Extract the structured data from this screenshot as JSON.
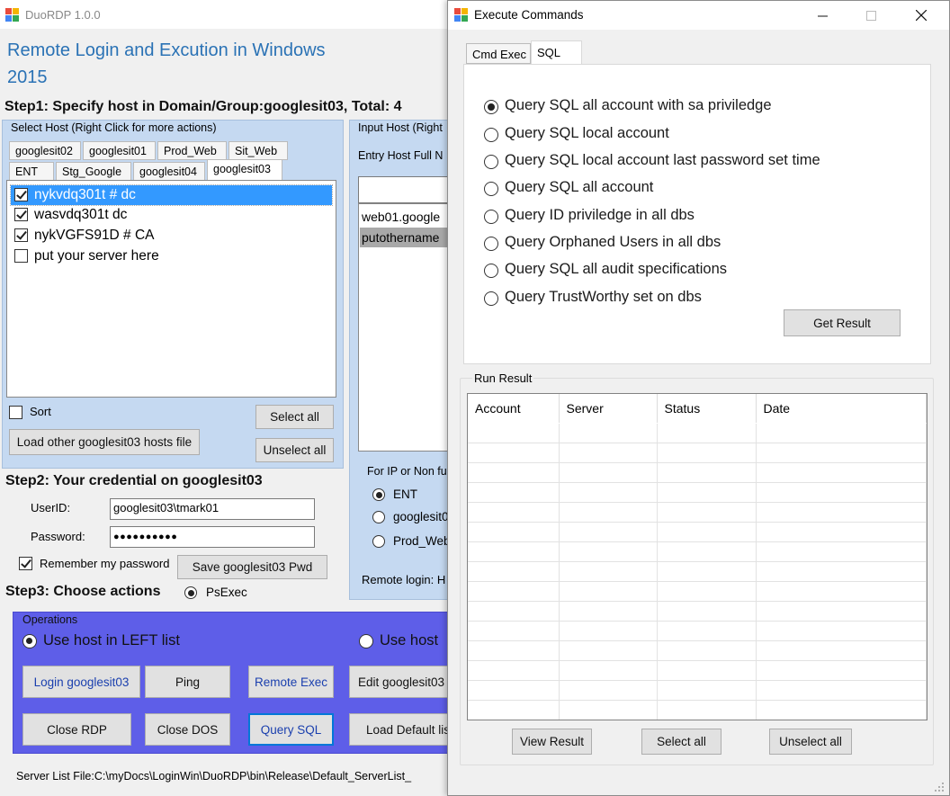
{
  "main_window": {
    "title": "DuoRDP 1.0.0",
    "heading_line1": "Remote Login and Excution in Windows",
    "heading_line2": "2015",
    "step1_label": "Step1: Specify host in Domain/Group:googlesit03, Total: 4",
    "select_host_group": {
      "title": "Select Host (Right Click for more actions)",
      "tabs_row1": [
        "googlesit02",
        "googlesit01",
        "Prod_Web",
        "Sit_Web"
      ],
      "tabs_row2": [
        "ENT",
        "Stg_Google",
        "googlesit04",
        "googlesit03"
      ],
      "selected_tab": "googlesit03",
      "hosts": [
        {
          "label": "nykvdq301t #  dc",
          "checked": true,
          "selected": true
        },
        {
          "label": "wasvdq301t   dc",
          "checked": true,
          "selected": false
        },
        {
          "label": "nykVGFS91D #  CA",
          "checked": true,
          "selected": false
        },
        {
          "label": "put your server here",
          "checked": false,
          "selected": false
        }
      ],
      "sort_label": "Sort",
      "sort_checked": false,
      "select_all_label": "Select all",
      "unselect_all_label": "Unselect all",
      "load_hosts_label": "Load other googlesit03 hosts file"
    },
    "input_host_group": {
      "title": "Input Host (Right",
      "entry_label": "Entry Host Full N",
      "entry_value": "",
      "list_items": [
        "web01.google",
        "putothername"
      ],
      "non_fqdn_group_title": "For IP or Non fu",
      "options": [
        "ENT",
        "googlesit0",
        "Prod_Web"
      ],
      "selected_option": "ENT",
      "remote_login_label": "Remote login: H"
    },
    "step2_label": "Step2: Your credential on googlesit03",
    "credentials": {
      "userid_label": "UserID:",
      "userid_value": "googlesit03\\tmark01",
      "password_label": "Password:",
      "password_mask": "●●●●●●●●●●",
      "remember_label": "Remember my password",
      "remember_checked": true,
      "save_pwd_label": "Save googlesit03 Pwd"
    },
    "step3_label": "Step3: Choose actions",
    "step3_psexec_label": "PsExec",
    "operations": {
      "title": "Operations",
      "use_left_label": "Use host in LEFT list",
      "use_right_label": "Use host",
      "buttons_row1": [
        "Login googlesit03",
        "Ping",
        "Remote Exec",
        "Edit googlesit03 l"
      ],
      "buttons_row2": [
        "Close RDP",
        "Close DOS",
        "Query SQL",
        "Load Default lis"
      ]
    },
    "status_bar": "Server List File:C:\\myDocs\\LoginWin\\DuoRDP\\bin\\Release\\Default_ServerList_"
  },
  "dialog": {
    "title": "Execute Commands",
    "tabs": [
      "Cmd Exec",
      "SQL"
    ],
    "selected_tab": "SQL",
    "sql_options": [
      "Query SQL all account with sa priviledge",
      "Query SQL local account",
      "Query SQL local account  last password set time",
      "Query SQL all  account",
      "Query ID priviledge in all dbs",
      "Query Orphaned Users in all dbs",
      "Query SQL all audit specifications",
      "Query TrustWorthy set on dbs"
    ],
    "selected_option_index": 0,
    "get_result_label": "Get Result",
    "run_result_title": "Run Result",
    "columns": [
      "Account",
      "Server",
      "Status",
      "Date"
    ],
    "view_result_label": "View Result",
    "select_all_label": "Select all",
    "unselect_all_label": "Unselect all"
  },
  "colors": {
    "heading_blue": "#2a72b5",
    "panel_blue": "#c5d9f1",
    "operations_purple": "#5e5ee8",
    "selection_blue": "#3399ff"
  }
}
